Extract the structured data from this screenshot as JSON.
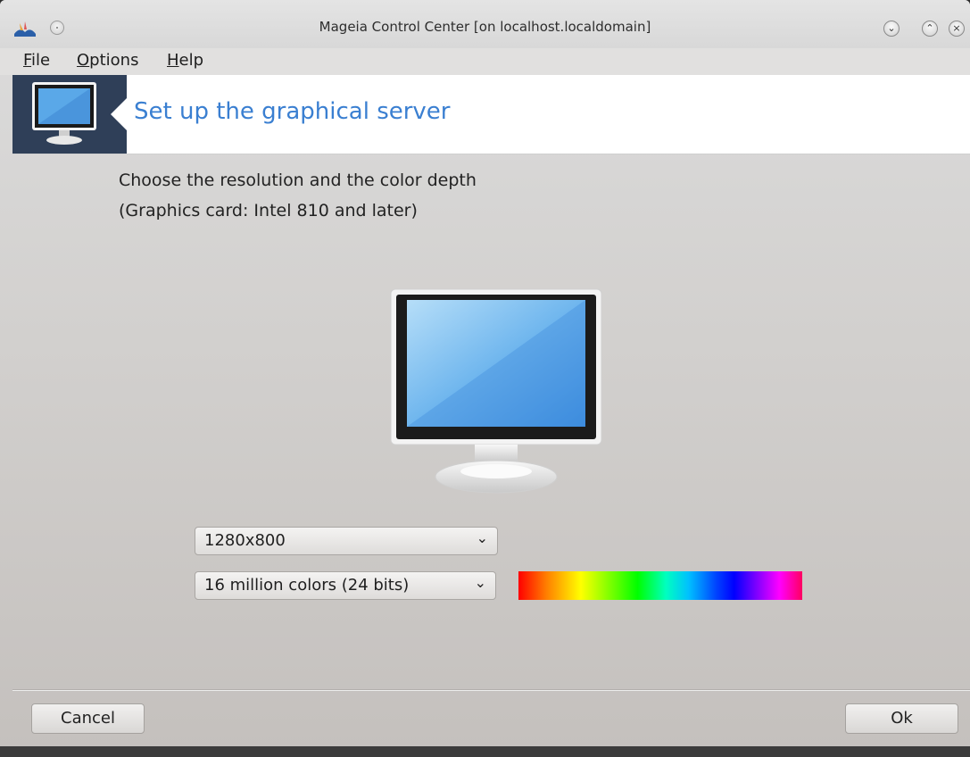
{
  "window": {
    "title": "Mageia Control Center  [on localhost.localdomain]",
    "controls": {
      "minimize_icon": "chevron-down-icon",
      "maximize_icon": "chevron-up-icon",
      "close_icon": "close-icon"
    }
  },
  "menu": {
    "items": [
      {
        "mnemonic": "F",
        "rest": "ile"
      },
      {
        "mnemonic": "O",
        "rest": "ptions"
      },
      {
        "mnemonic": "H",
        "rest": "elp"
      }
    ]
  },
  "banner": {
    "title": "Set up the graphical server",
    "icon": "monitor-icon"
  },
  "content": {
    "line1": "Choose the resolution and the color depth",
    "line2": "(Graphics card: Intel 810 and later)",
    "resolution": {
      "selected": "1280x800"
    },
    "color_depth": {
      "selected": "16 million colors (24 bits)"
    },
    "preview_icon": "monitor-icon"
  },
  "buttons": {
    "cancel": "Cancel",
    "ok": "Ok"
  },
  "colors": {
    "accent": "#3a7fd1",
    "banner_icon_bg": "#2f3f58"
  }
}
